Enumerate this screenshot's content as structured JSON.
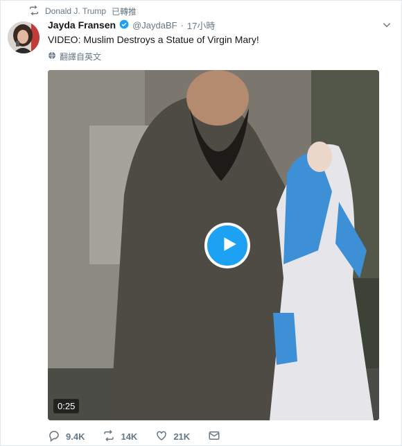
{
  "retweet": {
    "user": "Donald J. Trump",
    "label": "已轉推"
  },
  "tweet": {
    "name": "Jayda Fransen",
    "handle": "@JaydaBF",
    "separator": "·",
    "time": "17小時",
    "text": "VIDEO: Muslim Destroys a Statue of Virgin Mary!",
    "translate_label": "翻譯自英文"
  },
  "video": {
    "duration": "0:25"
  },
  "actions": {
    "replies": "9.4K",
    "retweets": "14K",
    "likes": "21K"
  },
  "colors": {
    "accent": "#1da1f2",
    "muted": "#657786",
    "text": "#14171a"
  },
  "icons": [
    "retweet-icon",
    "verified-badge-icon",
    "chevron-down-icon",
    "globe-icon",
    "play-icon",
    "reply-icon",
    "heart-icon",
    "direct-message-icon"
  ]
}
